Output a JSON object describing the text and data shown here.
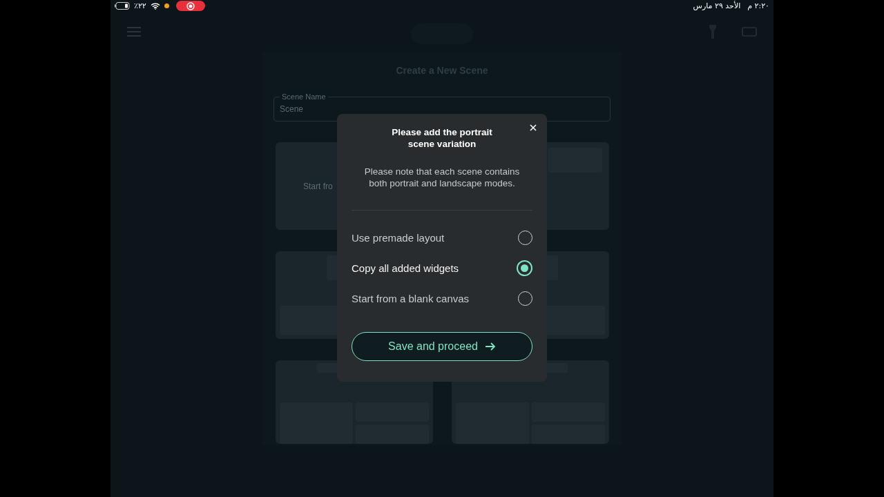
{
  "status_bar": {
    "battery": "٪٢٢",
    "recording": true,
    "date": "الأحد ٢٩ مارس",
    "time": "٢:٢٠ م"
  },
  "page": {
    "title": "Create a New Scene",
    "scene_name": {
      "label": "Scene Name",
      "value": "Scene"
    },
    "layout_cards": [
      {
        "kind": "wide",
        "text": "Start fro"
      },
      {
        "kind": "split"
      },
      {
        "kind": "split"
      },
      {
        "kind": "grid"
      },
      {
        "kind": "grid"
      }
    ]
  },
  "dialog": {
    "title": "Please add the portrait scene variation",
    "message": "Please note that each scene contains both portrait and landscape modes.",
    "options": [
      {
        "label": "Use premade layout",
        "selected": false
      },
      {
        "label": "Copy all added widgets",
        "selected": true
      },
      {
        "label": "Start from a blank canvas",
        "selected": false
      }
    ],
    "button": "Save and proceed"
  }
}
